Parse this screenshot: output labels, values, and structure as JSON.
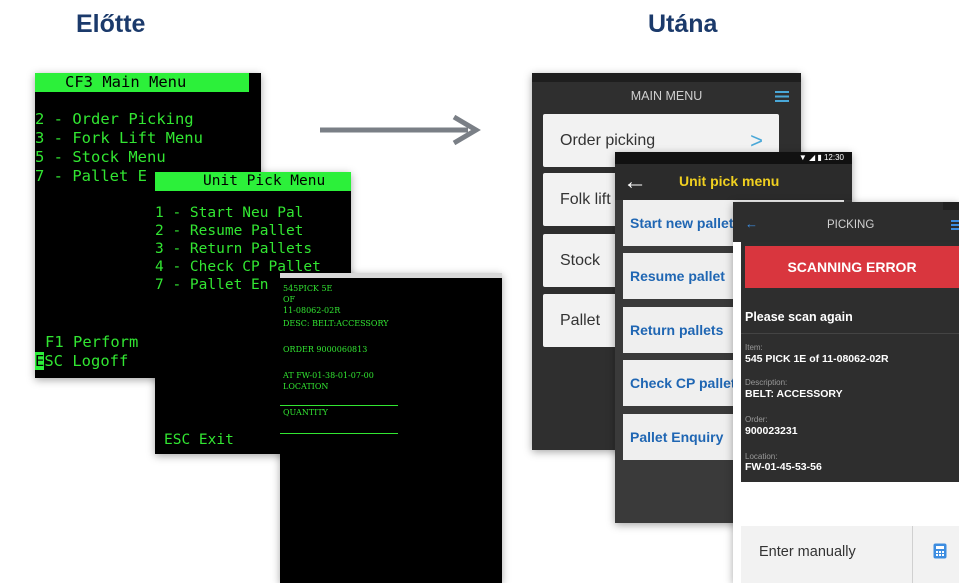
{
  "headings": {
    "before": "Előtte",
    "after": "Utána"
  },
  "terminal_main": {
    "header": "CF3 Main Menu",
    "items": [
      "2 - Order Picking",
      "3 - Fork Lift Menu",
      "5 - Stock Menu",
      "7 - Pallet E"
    ],
    "footer": [
      "F1 Perform",
      "ESC Logoff"
    ]
  },
  "terminal_unit_pick": {
    "header": "Unit Pick Menu",
    "items": [
      "1 - Start Neu Pal",
      "2 - Resume Pallet",
      "3 - Return Pallets",
      "4 - Check CP Pallet",
      "7 - Pallet En"
    ],
    "footer": "ESC Exit"
  },
  "terminal_detail": {
    "lines": [
      "545PICK 5E",
      "OF",
      "11-08062-02R",
      "DESC: BELT:ACCESSORY",
      "ORDER 9000060813",
      "AT FW-01-38-01-07-00",
      "LOCATION",
      "QUANTITY"
    ]
  },
  "app_main": {
    "title": "MAIN MENU",
    "items": [
      "Order picking",
      "Folk lift",
      "Stock",
      "Pallet"
    ],
    "chevron": ">"
  },
  "app_unit_pick": {
    "time": "12:30",
    "title": "Unit pick menu",
    "items": [
      "Start new pallet",
      "Resume pallet",
      "Return pallets",
      "Check CP pallet",
      "Pallet Enquiry"
    ]
  },
  "app_picking": {
    "title": "PICKING",
    "error": "SCANNING ERROR",
    "message": "Please scan again",
    "fields": [
      {
        "label": "Item:",
        "value": "545 PICK 1E of 11-08062-02R"
      },
      {
        "label": "Description:",
        "value": "BELT: ACCESSORY"
      },
      {
        "label": "Order:",
        "value": "900023231"
      },
      {
        "label": "Location:",
        "value": "FW-01-45-53-56"
      }
    ],
    "enter_manually": "Enter manually",
    "colors": {
      "error": "#d9363e",
      "link": "#1f66b3",
      "title": "#f0d020"
    }
  }
}
